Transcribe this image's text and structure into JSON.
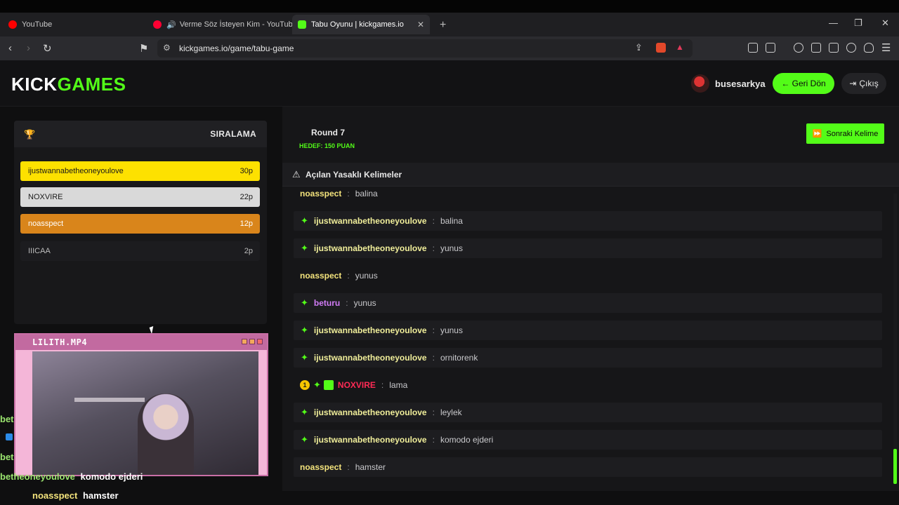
{
  "browser": {
    "tabs": [
      {
        "title": "YouTube",
        "icon": "youtube-icon",
        "color": "#ff0000"
      },
      {
        "title": "Verme Söz İsteyen Kim - YouTube",
        "icon": "youtube-icon",
        "color": "#ff0033"
      },
      {
        "title": "Tabu Oyunu | kickgames.io",
        "icon": "kick-icon",
        "color": "#53fc18"
      }
    ],
    "url": "kickgames.io/game/tabu-game"
  },
  "header": {
    "logo_kick": "KICK",
    "logo_games": "GAMES",
    "username": "busesarkya",
    "back_label": "← Geri Dön",
    "exit_label": "Çıkış"
  },
  "leaderboard": {
    "title": "SIRALAMA",
    "rows": [
      {
        "name": "ijustwannabetheoneyoulove",
        "score": "30p",
        "bg": "#fde100",
        "fg": "#1a1a1a"
      },
      {
        "name": "NOXVIRE",
        "score": "22p",
        "bg": "#d9d9d9",
        "fg": "#1a1a1a"
      },
      {
        "name": "noasspect",
        "score": "12p",
        "bg": "#d9851b",
        "fg": "#ffffff"
      },
      {
        "name": "IIICAA",
        "score": "2p",
        "bg": "#1c1c1f",
        "fg": "#bdbdbd"
      }
    ]
  },
  "webcam": {
    "title": "LILITH.MP4"
  },
  "overlay_chat": {
    "line_a": "bet",
    "line_b": "bet",
    "line_c_user": "betheoneyoulove",
    "line_c_word": "komodo ejderi",
    "line_d_user": "noasspect",
    "line_d_word": "hamster"
  },
  "game": {
    "round": "Round 7",
    "target": "HEDEF: 150 PUAN",
    "next_label": "Sonraki Kelime",
    "banned_title": "Açılan Yasaklı Kelimeler"
  },
  "chat": [
    {
      "user": "noasspect",
      "word": "balina",
      "user_color": "#f3e37c",
      "spark": false
    },
    {
      "user": "ijustwannabetheoneyoulove",
      "word": "balina",
      "user_color": "#f0ee9a",
      "spark": true
    },
    {
      "user": "ijustwannabetheoneyoulove",
      "word": "yunus",
      "user_color": "#f0ee9a",
      "spark": true
    },
    {
      "user": "noasspect",
      "word": "yunus",
      "user_color": "#f3e37c",
      "spark": false
    },
    {
      "user": "beturu",
      "word": "yunus",
      "user_color": "#d27cf7",
      "spark": true
    },
    {
      "user": "ijustwannabetheoneyoulove",
      "word": "yunus",
      "user_color": "#f0ee9a",
      "spark": true
    },
    {
      "user": "ijustwannabetheoneyoulove",
      "word": "ornitorenk",
      "user_color": "#f0ee9a",
      "spark": true
    },
    {
      "user": "NOXVIRE",
      "word": "lama",
      "user_color": "#ff2a55",
      "spark": true,
      "badge": "1",
      "gift": true
    },
    {
      "user": "ijustwannabetheoneyoulove",
      "word": "leylek",
      "user_color": "#f0ee9a",
      "spark": true
    },
    {
      "user": "ijustwannabetheoneyoulove",
      "word": "komodo ejderi",
      "user_color": "#f0ee9a",
      "spark": true
    },
    {
      "user": "noasspect",
      "word": "hamster",
      "user_color": "#f3e37c",
      "spark": false
    }
  ],
  "colors": {
    "accent": "#53fc18"
  }
}
